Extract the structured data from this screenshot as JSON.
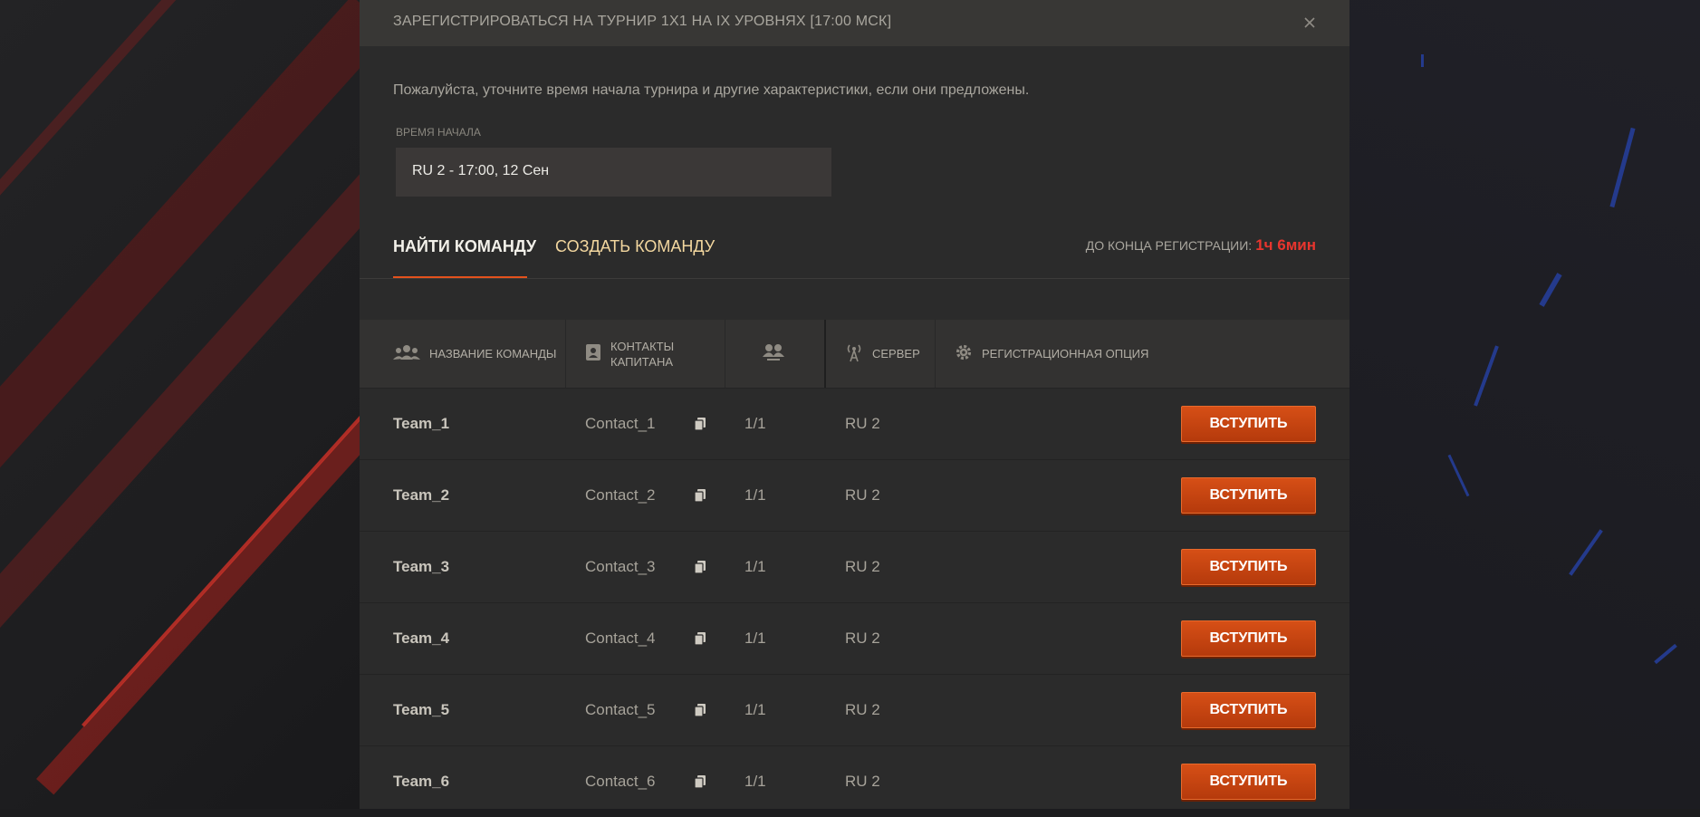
{
  "dialog": {
    "title": "ЗАРЕГИСТРИРОВАТЬСЯ НА ТУРНИР 1X1 НА IX УРОВНЯХ [17:00 МСК]",
    "intro": "Пожалуйста, уточните время начала турнира и другие характеристики, если они предложены.",
    "start_time_label": "ВРЕМЯ НАЧАЛА",
    "start_time_value": "RU 2 - 17:00, 12 Сен"
  },
  "tabs": {
    "find": "НАЙТИ КОМАНДУ",
    "create": "СОЗДАТЬ КОМАНДУ",
    "active": "find"
  },
  "deadline": {
    "label": "ДО КОНЦА РЕГИСТРАЦИИ:",
    "time": "1ч 6мин"
  },
  "table": {
    "headers": {
      "team": "НАЗВАНИЕ КОМАНДЫ",
      "captain_line1": "КОНТАКТЫ",
      "captain_line2": "КАПИТАНА",
      "server": "СЕРВЕР",
      "option": "РЕГИСТРАЦИОННАЯ ОПЦИЯ"
    },
    "rows": [
      {
        "team": "Team_1",
        "contact": "Contact_1",
        "members": "1/1",
        "server": "RU 2",
        "action": "ВСТУПИТЬ"
      },
      {
        "team": "Team_2",
        "contact": "Contact_2",
        "members": "1/1",
        "server": "RU 2",
        "action": "ВСТУПИТЬ"
      },
      {
        "team": "Team_3",
        "contact": "Contact_3",
        "members": "1/1",
        "server": "RU 2",
        "action": "ВСТУПИТЬ"
      },
      {
        "team": "Team_4",
        "contact": "Contact_4",
        "members": "1/1",
        "server": "RU 2",
        "action": "ВСТУПИТЬ"
      },
      {
        "team": "Team_5",
        "contact": "Contact_5",
        "members": "1/1",
        "server": "RU 2",
        "action": "ВСТУПИТЬ"
      },
      {
        "team": "Team_6",
        "contact": "Contact_6",
        "members": "1/1",
        "server": "RU 2",
        "action": "ВСТУПИТЬ"
      }
    ]
  },
  "colors": {
    "accent": "#e4521d",
    "deadline": "#e8352e",
    "active_tab": "#f3f1ea",
    "inactive_tab": "#f3d79f"
  }
}
